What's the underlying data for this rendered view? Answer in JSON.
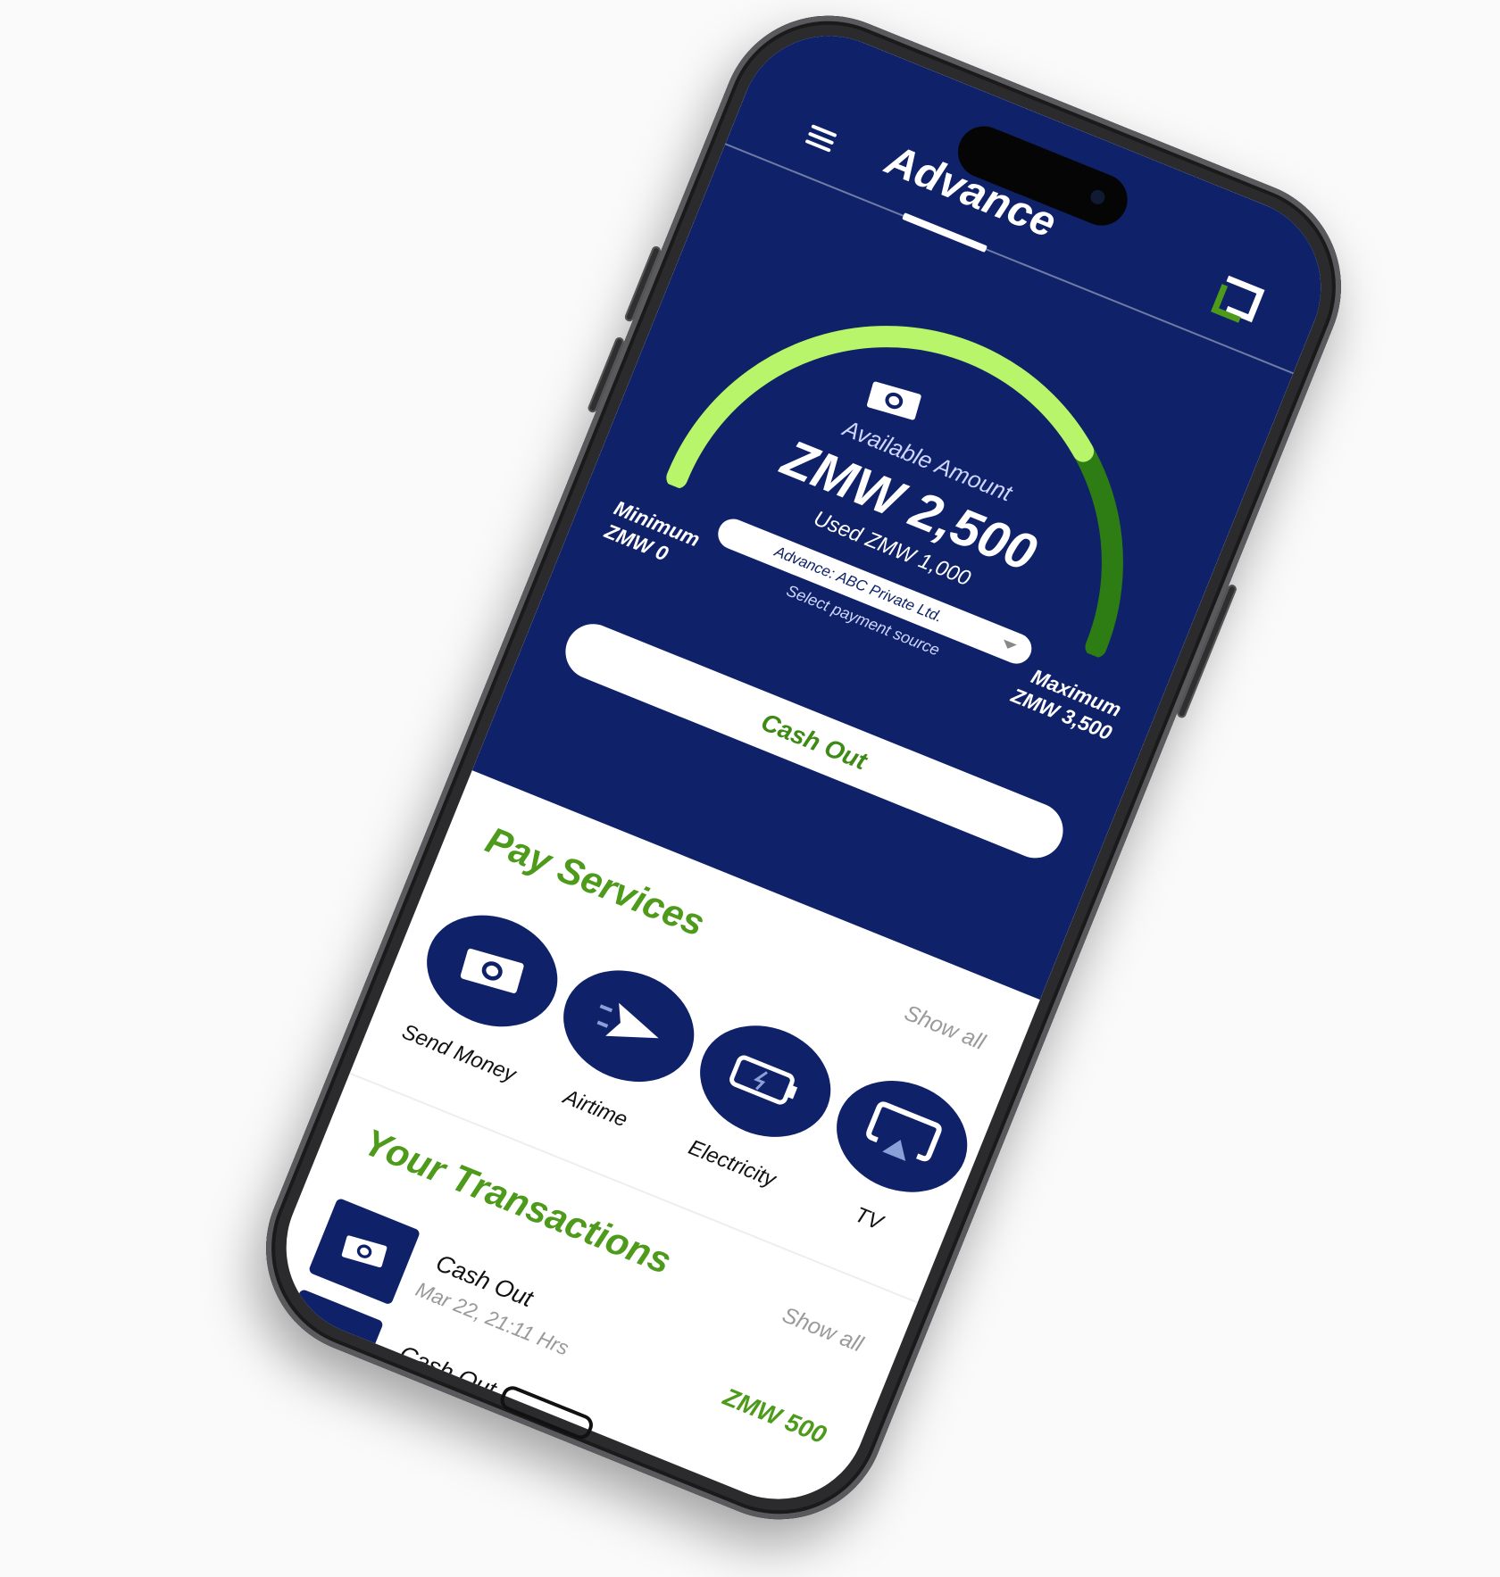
{
  "app": {
    "title": "Advance",
    "accent_color": "#0f2269",
    "brand_green": "#4e9a1b",
    "gauge_green": "#b8f56a"
  },
  "gauge": {
    "icon": "money-icon",
    "available_label": "Available Amount",
    "available_amount": "ZMW 2,500",
    "used_label": "Used ZMW 1,000",
    "min_label": "Minimum",
    "min_value": "ZMW 0",
    "max_label": "Maximum",
    "max_value": "ZMW 3,500",
    "fill_fraction": 0.714
  },
  "payment_source": {
    "value": "Advance: ABC Private Ltd.",
    "hint": "Select payment source"
  },
  "cashout": {
    "label": "Cash Out"
  },
  "pay_services": {
    "title": "Pay Services",
    "show_all": "Show all",
    "items": [
      {
        "label": "Send Money",
        "icon": "money-icon"
      },
      {
        "label": "Airtime",
        "icon": "send-icon"
      },
      {
        "label": "Electricity",
        "icon": "battery-icon"
      },
      {
        "label": "TV",
        "icon": "tv-icon"
      }
    ]
  },
  "transactions": {
    "title": "Your Transactions",
    "show_all": "Show all",
    "items": [
      {
        "name": "Cash Out",
        "date": "Mar 22, 21:11 Hrs",
        "amount": "ZMW 500"
      },
      {
        "name": "Cash Out",
        "date": "",
        "amount": ""
      }
    ]
  }
}
